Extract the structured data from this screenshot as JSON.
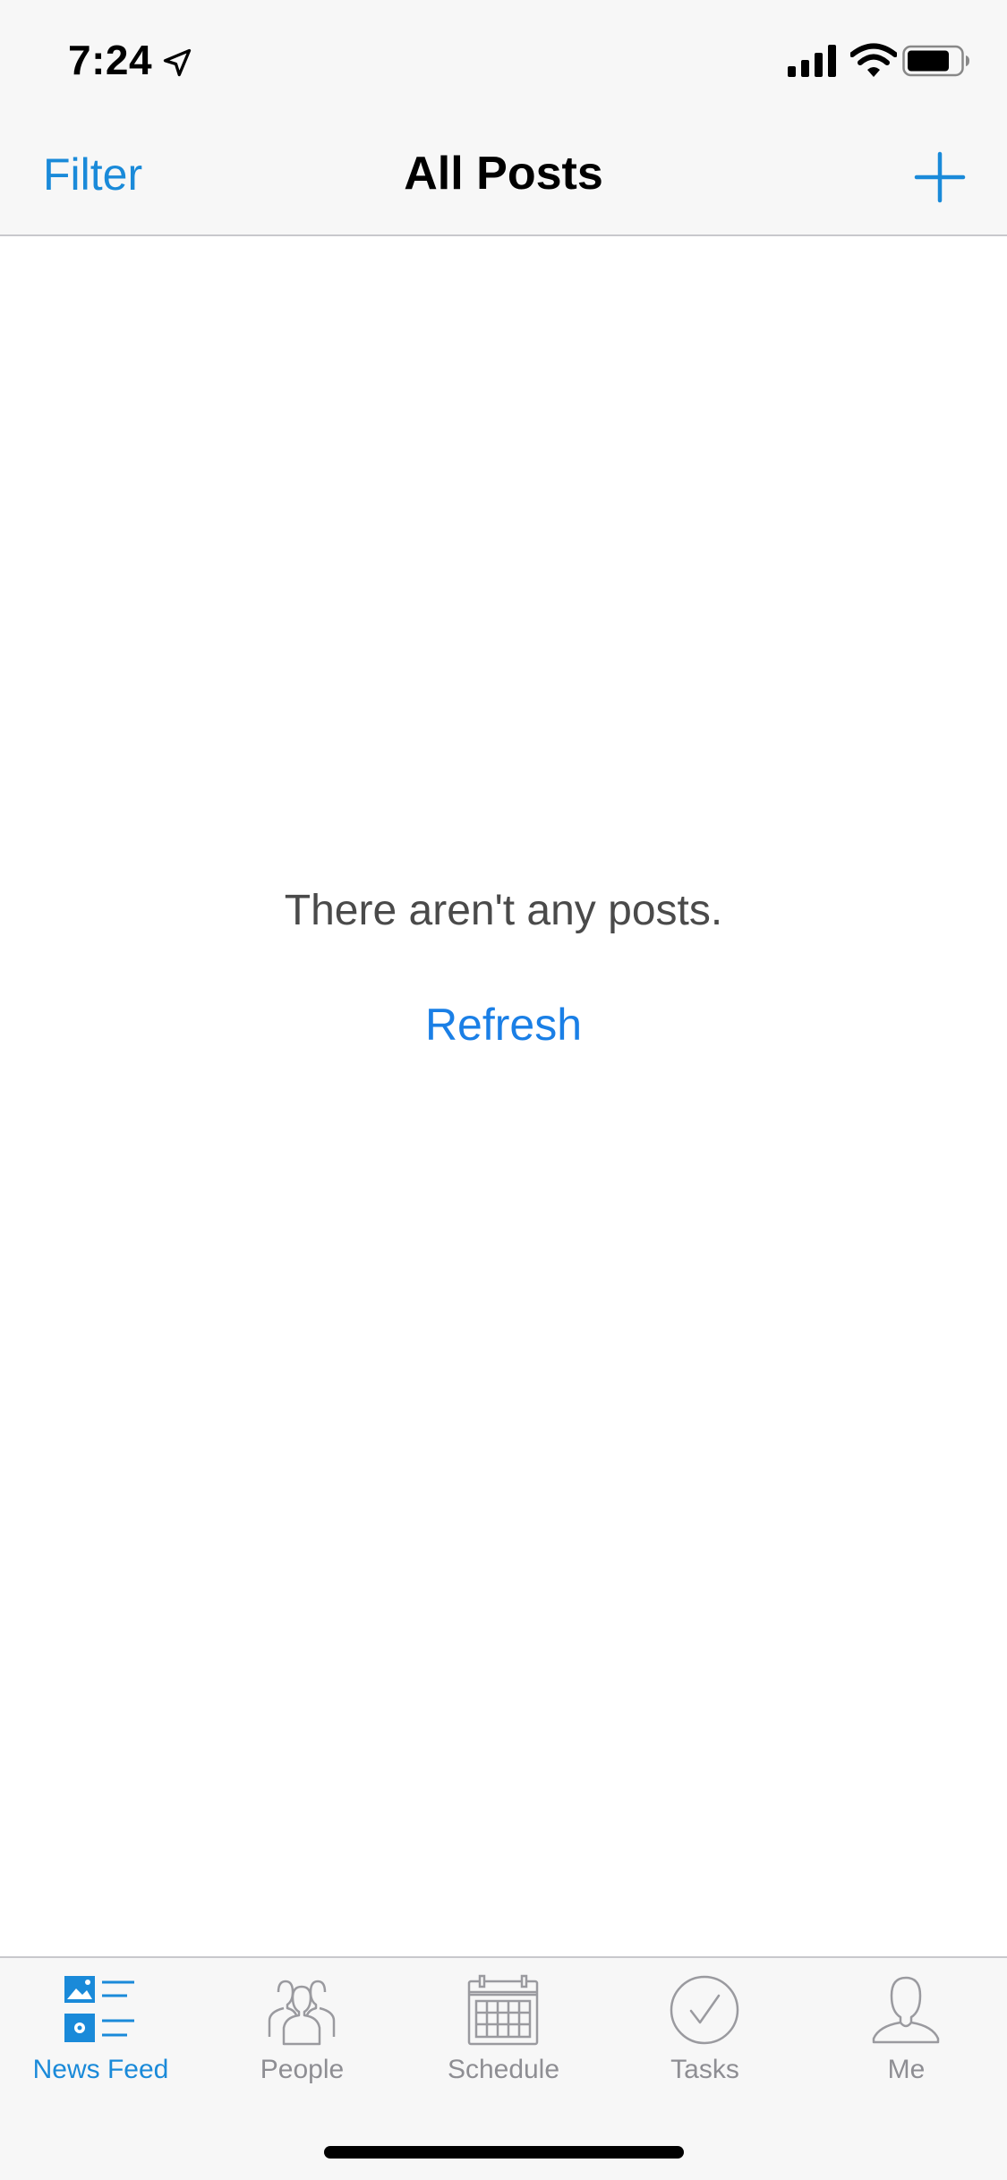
{
  "status_bar": {
    "time": "7:24"
  },
  "nav_bar": {
    "filter_label": "Filter",
    "title": "All Posts"
  },
  "content": {
    "empty_message": "There aren't any posts.",
    "refresh_label": "Refresh"
  },
  "tab_bar": {
    "items": [
      {
        "label": "News Feed",
        "icon": "news-feed-icon",
        "active": true
      },
      {
        "label": "People",
        "icon": "people-icon",
        "active": false
      },
      {
        "label": "Schedule",
        "icon": "calendar-icon",
        "active": false
      },
      {
        "label": "Tasks",
        "icon": "checkmark-circle-icon",
        "active": false
      },
      {
        "label": "Me",
        "icon": "person-icon",
        "active": false
      }
    ]
  },
  "colors": {
    "accent": "#1a8ad9",
    "link": "#1a7fe6",
    "inactive_tab": "#8e8e93",
    "bar_background": "#f7f7f7"
  }
}
